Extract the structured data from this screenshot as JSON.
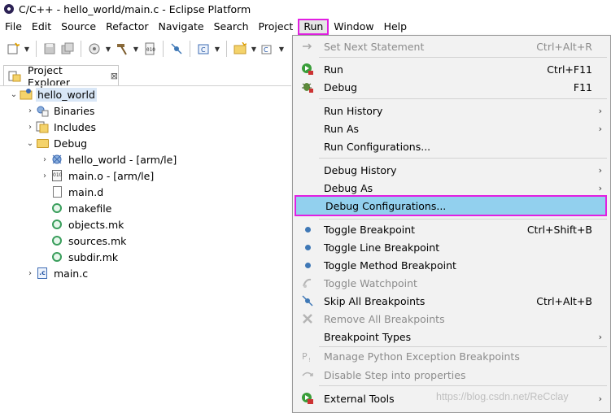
{
  "window": {
    "title": "C/C++ - hello_world/main.c - Eclipse Platform"
  },
  "menubar": {
    "items": [
      "File",
      "Edit",
      "Source",
      "Refactor",
      "Navigate",
      "Search",
      "Project",
      "Run",
      "Window",
      "Help"
    ]
  },
  "explorer": {
    "tab_label": "Project Explorer",
    "close_glyph": "⊠",
    "nodes": {
      "project": "hello_world",
      "binaries": "Binaries",
      "includes": "Includes",
      "debug": "Debug",
      "hello_bin": "hello_world - [arm/le]",
      "main_o": "main.o - [arm/le]",
      "main_d": "main.d",
      "makefile": "makefile",
      "objects_mk": "objects.mk",
      "sources_mk": "sources.mk",
      "subdir_mk": "subdir.mk",
      "main_c": "main.c"
    }
  },
  "run_menu": {
    "set_next_statement": {
      "label": "Set Next Statement",
      "accel": "Ctrl+Alt+R"
    },
    "run": {
      "label": "Run",
      "accel": "Ctrl+F11"
    },
    "debug": {
      "label": "Debug",
      "accel": "F11"
    },
    "run_history": {
      "label": "Run History"
    },
    "run_as": {
      "label": "Run As"
    },
    "run_configurations": {
      "label": "Run Configurations..."
    },
    "debug_history": {
      "label": "Debug History"
    },
    "debug_as": {
      "label": "Debug As"
    },
    "debug_configurations": {
      "label": "Debug Configurations..."
    },
    "toggle_breakpoint": {
      "label": "Toggle Breakpoint",
      "accel": "Ctrl+Shift+B"
    },
    "toggle_line_breakpoint": {
      "label": "Toggle Line Breakpoint"
    },
    "toggle_method_breakpoint": {
      "label": "Toggle Method Breakpoint"
    },
    "toggle_watchpoint": {
      "label": "Toggle Watchpoint"
    },
    "skip_all_breakpoints": {
      "label": "Skip All Breakpoints",
      "accel": "Ctrl+Alt+B"
    },
    "remove_all_breakpoints": {
      "label": "Remove All Breakpoints"
    },
    "breakpoint_types": {
      "label": "Breakpoint Types"
    },
    "manage_python_exception_breakpoints": {
      "label": "Manage Python Exception Breakpoints"
    },
    "disable_step_into_properties": {
      "label": "Disable Step into properties"
    },
    "external_tools": {
      "label": "External Tools"
    }
  },
  "watermark": "https://blog.csdn.net/ReCclay",
  "colors": {
    "highlight_border": "#e21fe2",
    "highlight_fill": "#92d0ee",
    "menu_bg": "#f2f2f2"
  }
}
